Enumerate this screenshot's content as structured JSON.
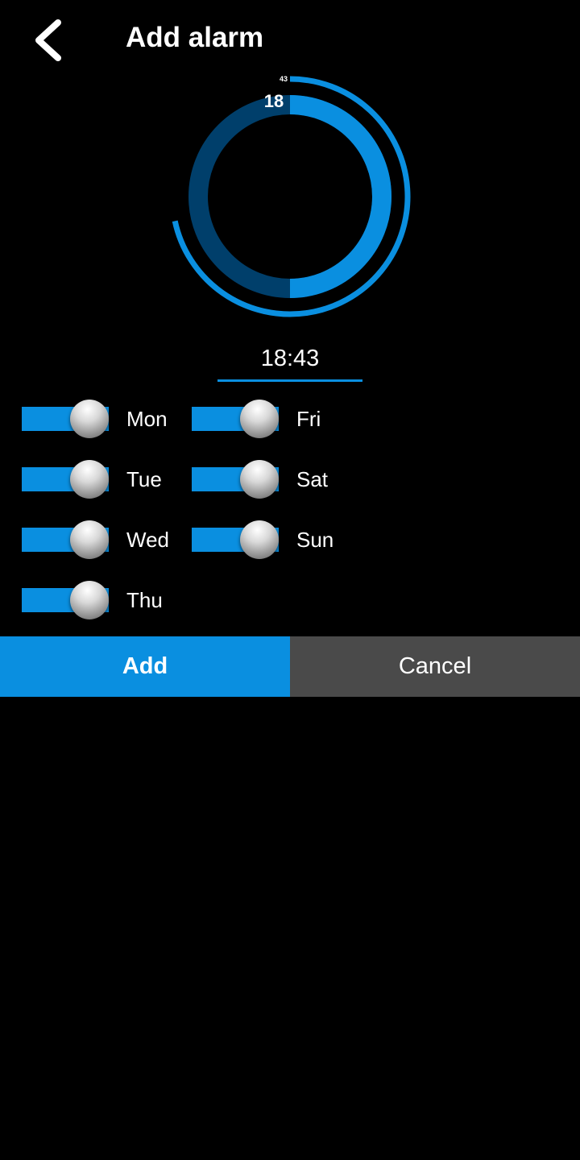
{
  "header": {
    "title": "Add alarm",
    "back_icon": "chevron-left-icon"
  },
  "dial": {
    "hour_label": "18",
    "minute_label": "43",
    "hour": 18,
    "minute": 43,
    "colors": {
      "active": "#0a8fe0",
      "inactive": "#003f6b"
    }
  },
  "time_input": {
    "value": "18:43"
  },
  "days": [
    {
      "label": "Mon",
      "on": true
    },
    {
      "label": "Tue",
      "on": true
    },
    {
      "label": "Wed",
      "on": true
    },
    {
      "label": "Thu",
      "on": true
    },
    {
      "label": "Fri",
      "on": true
    },
    {
      "label": "Sat",
      "on": true
    },
    {
      "label": "Sun",
      "on": true
    }
  ],
  "actions": {
    "add_label": "Add",
    "cancel_label": "Cancel"
  },
  "colors": {
    "accent": "#0a8fe0",
    "cancel_bg": "#4a4a4a",
    "background": "#000000"
  }
}
